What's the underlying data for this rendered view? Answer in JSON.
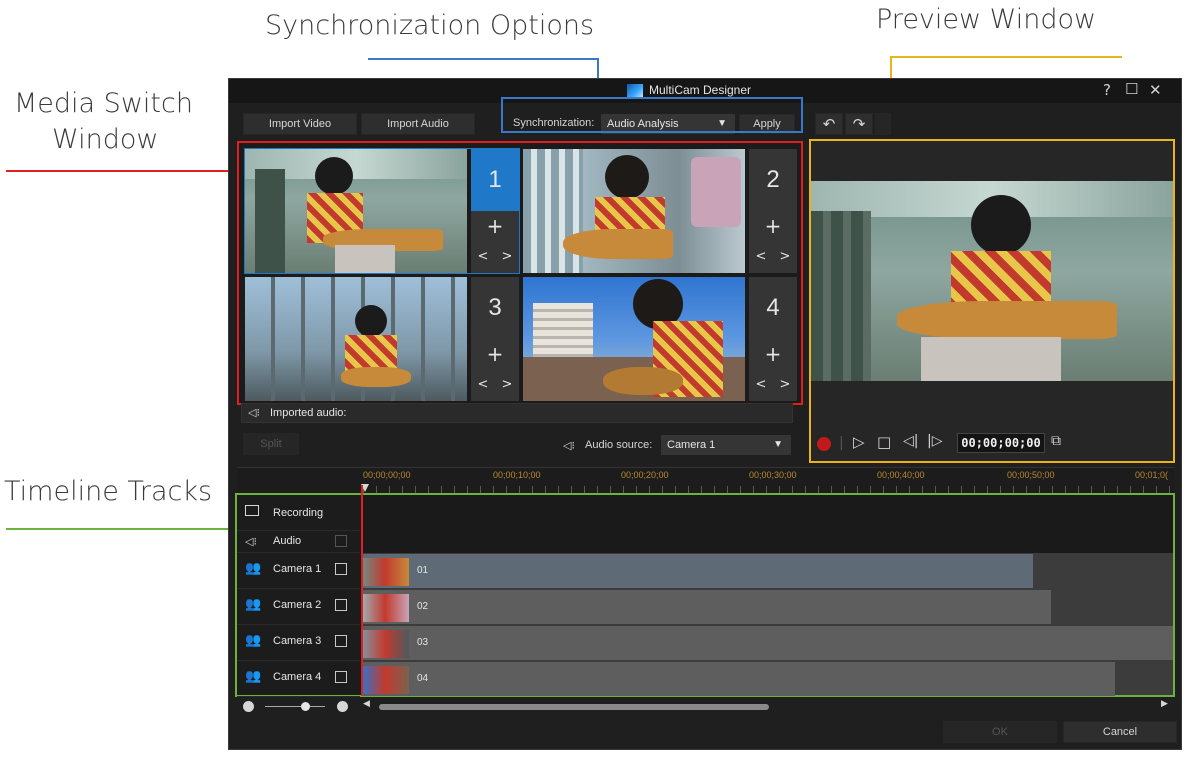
{
  "annotations": {
    "sync_options": "Synchronization Options",
    "preview_window": "Preview Window",
    "media_switch_line1": "Media Switch",
    "media_switch_line2": "Window",
    "timeline_tracks": "Timeline Tracks"
  },
  "window": {
    "title": "MultiCam Designer",
    "help": "?",
    "maximize": "☐",
    "close": "✕"
  },
  "toolbar": {
    "import_video": "Import Video",
    "import_audio": "Import Audio",
    "sync_label": "Synchronization:",
    "sync_value": "Audio Analysis",
    "apply": "Apply",
    "undo": "↶",
    "redo": "↷"
  },
  "cameras": [
    {
      "number": "1",
      "plus": "+",
      "prev": "<",
      "next": ">"
    },
    {
      "number": "2",
      "plus": "+",
      "prev": "<",
      "next": ">"
    },
    {
      "number": "3",
      "plus": "+",
      "prev": "<",
      "next": ">"
    },
    {
      "number": "4",
      "plus": "+",
      "prev": "<",
      "next": ">"
    }
  ],
  "audio": {
    "imported_label": "Imported audio:",
    "split": "Split",
    "source_label": "Audio source:",
    "source_value": "Camera 1"
  },
  "player": {
    "timecode": "00;00;00;00"
  },
  "ruler": [
    "00;00;00;00",
    "00;00;10;00",
    "00;00;20;00",
    "00;00;30;00",
    "00;00;40;00",
    "00;00;50;00",
    "00;01;0("
  ],
  "tracks": {
    "recording": "Recording",
    "audio": "Audio",
    "cameras": [
      {
        "label": "Camera 1",
        "clip": "01"
      },
      {
        "label": "Camera 2",
        "clip": "02"
      },
      {
        "label": "Camera 3",
        "clip": "03"
      },
      {
        "label": "Camera 4",
        "clip": "04"
      }
    ]
  },
  "footer": {
    "ok": "OK",
    "cancel": "Cancel"
  },
  "colors": {
    "media_switch_border": "#e02020",
    "sync_border": "#3a78c8",
    "preview_border": "#e8b418",
    "timeline_border": "#6cb33e",
    "active_camera": "#1f78c8"
  }
}
